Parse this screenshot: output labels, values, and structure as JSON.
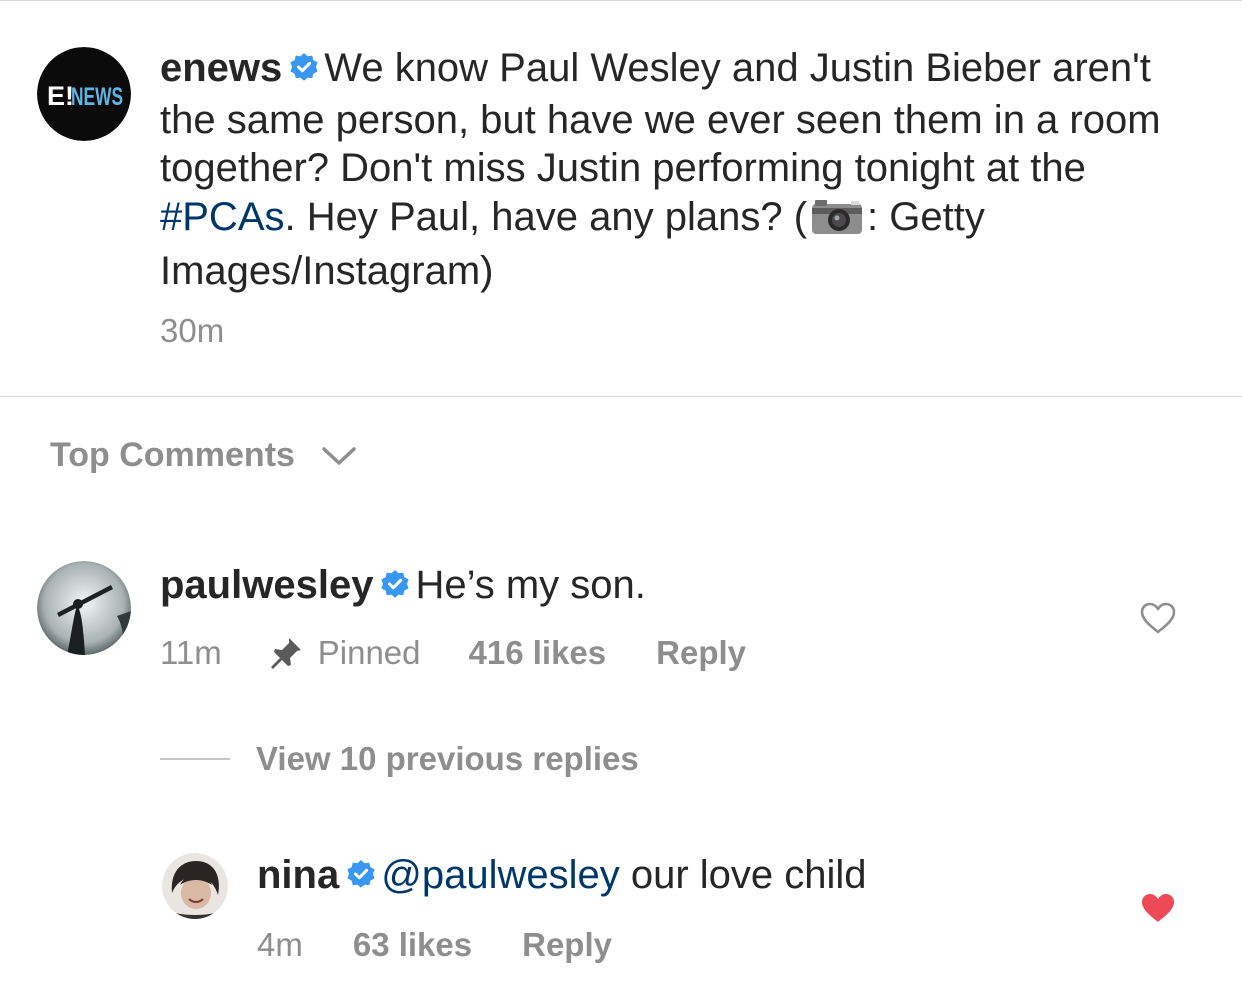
{
  "post": {
    "username": "enews",
    "avatar_text_e": "E!",
    "avatar_text_news": "NEWS",
    "caption_part1": "We know Paul Wesley and Justin Bieber aren't the same person, but have we ever seen them in a room together? Don't miss Justin performing tonight at the ",
    "hashtag": "#PCAs",
    "caption_part2": ". Hey Paul, have any plans? (",
    "caption_part3": ": Getty Images/Instagram)",
    "time": "30m",
    "icons": {
      "verified": "verified-badge-icon",
      "camera": "camera-emoji-icon"
    }
  },
  "comments_header": {
    "label": "Top Comments",
    "icon": "chevron-down-icon"
  },
  "comments": [
    {
      "username": "paulwesley",
      "text": "He’s my son.",
      "time": "11m",
      "pinned_label": "Pinned",
      "likes": "416 likes",
      "reply_label": "Reply",
      "liked": false
    }
  ],
  "view_replies": "View 10 previous replies",
  "replies": [
    {
      "username": "nina",
      "mention": "@paulwesley",
      "text": " our love child",
      "time": "4m",
      "likes": "63 likes",
      "reply_label": "Reply",
      "liked": true
    }
  ],
  "colors": {
    "verified": "#3897f0",
    "heart_liked": "#ed4956",
    "link": "#00376b",
    "muted": "#8e8e8e"
  }
}
